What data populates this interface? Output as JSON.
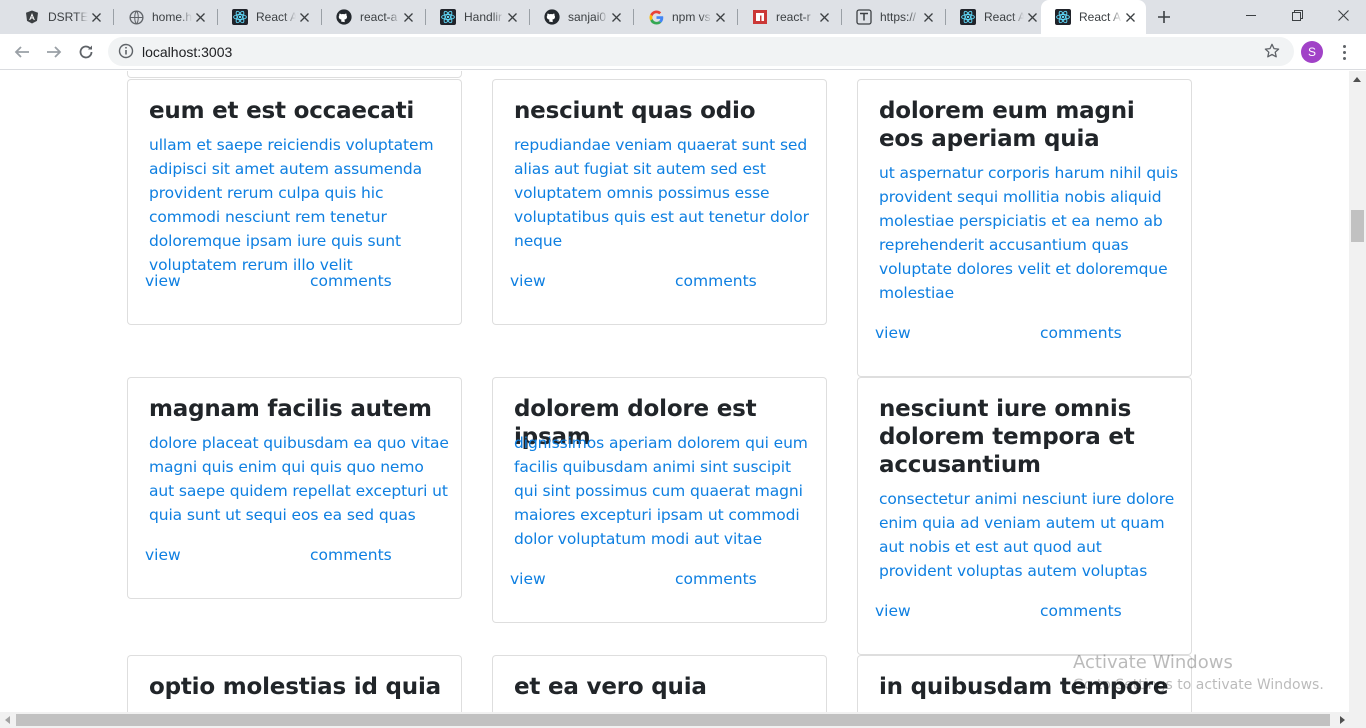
{
  "browser": {
    "tabs": [
      {
        "title": "DSRTEx",
        "icon": "angular-icon"
      },
      {
        "title": "home.h",
        "icon": "globe-icon"
      },
      {
        "title": "React A",
        "icon": "react-icon"
      },
      {
        "title": "react-a",
        "icon": "github-icon"
      },
      {
        "title": "Handlir",
        "icon": "react-icon"
      },
      {
        "title": "sanjai0",
        "icon": "github-icon"
      },
      {
        "title": "npm vs",
        "icon": "google-icon"
      },
      {
        "title": "react-r",
        "icon": "npm-icon"
      },
      {
        "title": "https://",
        "icon": "loading-icon"
      },
      {
        "title": "React A",
        "icon": "react-icon"
      },
      {
        "title": "React A",
        "icon": "react-icon",
        "active": true
      }
    ],
    "url": "localhost:3003",
    "profile_initial": "S",
    "accent_color": "#0e7fe1",
    "profile_color": "#a142c7"
  },
  "posts": [
    {
      "title": "eum et est occaecati",
      "body": "ullam et saepe reiciendis voluptatem adipisci sit amet autem assumenda provident rerum culpa quis hic commodi nesciunt rem tenetur doloremque ipsam iure quis sunt voluptatem rerum illo velit",
      "view": "view",
      "comments": "comments"
    },
    {
      "title": "nesciunt quas odio",
      "body": "repudiandae veniam quaerat sunt sed alias aut fugiat sit autem sed est voluptatem omnis possimus esse voluptatibus quis est aut tenetur dolor neque",
      "view": "view",
      "comments": "comments"
    },
    {
      "title": "dolorem eum magni eos aperiam quia",
      "body": "ut aspernatur corporis harum nihil quis provident sequi mollitia nobis aliquid molestiae perspiciatis et ea nemo ab reprehenderit accusantium quas voluptate dolores velit et doloremque molestiae",
      "view": "view",
      "comments": "comments"
    },
    {
      "title": "magnam facilis autem",
      "body": "dolore placeat quibusdam ea quo vitae magni quis enim qui quis quo nemo aut saepe quidem repellat excepturi ut quia sunt ut sequi eos ea sed quas",
      "view": "view",
      "comments": "comments"
    },
    {
      "title": "dolorem dolore est ipsam",
      "body": "dignissimos aperiam dolorem qui eum facilis quibusdam animi sint suscipit qui sint possimus cum quaerat magni maiores excepturi ipsam ut commodi dolor voluptatum modi aut vitae",
      "view": "view",
      "comments": "comments"
    },
    {
      "title": "nesciunt iure omnis dolorem tempora et accusantium",
      "body": "consectetur animi nesciunt iure dolore enim quia ad veniam autem ut quam aut nobis et est aut quod aut provident voluptas autem voluptas",
      "view": "view",
      "comments": "comments"
    },
    {
      "title": "optio molestias id quia",
      "body": "",
      "view": "",
      "comments": ""
    },
    {
      "title": "et ea vero quia",
      "body": "",
      "view": "",
      "comments": ""
    },
    {
      "title": "in quibusdam tempore",
      "body": "",
      "view": "",
      "comments": ""
    }
  ],
  "watermark": {
    "title": "Activate Windows",
    "subtitle": "Go to Settings to activate Windows."
  }
}
